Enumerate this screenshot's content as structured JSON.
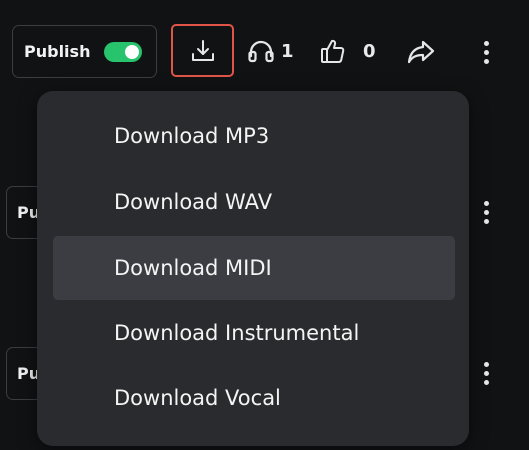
{
  "toolbar": {
    "publish_label": "Publish",
    "publish_on": true,
    "plays_count": "1",
    "likes_count": "0",
    "icons": {
      "download": "download-icon",
      "plays": "headphones-icon",
      "likes": "thumbs-up-icon",
      "share": "share-icon",
      "more": "more-vertical-icon"
    }
  },
  "rows": [
    {
      "publish_label": "Pu"
    },
    {
      "publish_label": "Pu"
    }
  ],
  "menu": {
    "items": [
      {
        "label": "Download MP3"
      },
      {
        "label": "Download WAV"
      },
      {
        "label": "Download MIDI"
      },
      {
        "label": "Download Instrumental"
      },
      {
        "label": "Download Vocal"
      }
    ],
    "highlighted_item": "Download MIDI"
  },
  "colors": {
    "background": "#111214",
    "toggle_on": "#27c46d",
    "download_focus_border": "#e05548",
    "menu_bg": "#2a2b2e",
    "menu_hover": "#3c3d42"
  }
}
